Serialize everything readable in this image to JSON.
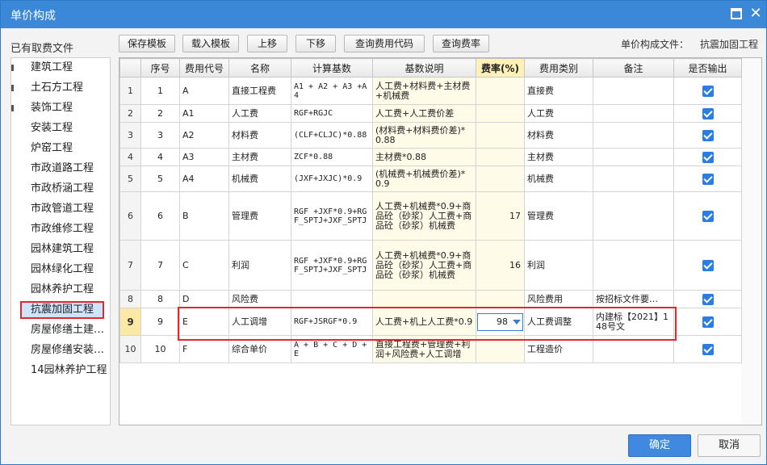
{
  "window": {
    "title": "单价构成"
  },
  "left_panel": {
    "label": "已有取费文件",
    "items": [
      "建筑工程",
      "土石方工程",
      "装饰工程",
      "安装工程",
      "炉窑工程",
      "市政道路工程",
      "市政桥涵工程",
      "市政管道工程",
      "市政维修工程",
      "园林建筑工程",
      "园林绿化工程",
      "园林养护工程",
      "抗震加固工程",
      "房屋修缮土建…",
      "房屋修缮安装…",
      "14园林养护工程"
    ],
    "selected": "抗震加固工程"
  },
  "toolbar": {
    "buttons": [
      "保存模板",
      "载入模板",
      "上移",
      "下移",
      "查询费用代码",
      "查询费率"
    ],
    "file_label": "单价构成文件：",
    "file_value": "抗震加固工程"
  },
  "table": {
    "headers": [
      "序号",
      "费用代号",
      "名称",
      "计算基数",
      "基数说明",
      "费率(%)",
      "费用类别",
      "备注",
      "是否输出"
    ],
    "rows": [
      {
        "idx": "1",
        "seq": "1",
        "code": "A",
        "name": "直接工程费",
        "base": "A1 + A2 + A3 +A4",
        "desc": "人工费+材料费+主材费+机械费",
        "rate": "",
        "category": "直接费",
        "note": "",
        "output": true
      },
      {
        "idx": "2",
        "seq": "2",
        "code": "A1",
        "name": "人工费",
        "base": "RGF+RGJC",
        "desc": "人工费+人工费价差",
        "rate": "",
        "category": "人工费",
        "note": "",
        "output": true
      },
      {
        "idx": "3",
        "seq": "3",
        "code": "A2",
        "name": "材料费",
        "base": "(CLF+CLJC)*0.88",
        "desc": "(材料费+材料费价差)*0.88",
        "rate": "",
        "category": "材料费",
        "note": "",
        "output": true
      },
      {
        "idx": "4",
        "seq": "4",
        "code": "A3",
        "name": "主材费",
        "base": "ZCF*0.88",
        "desc": "主材费*0.88",
        "rate": "",
        "category": "主材费",
        "note": "",
        "output": true
      },
      {
        "idx": "5",
        "seq": "5",
        "code": "A4",
        "name": "机械费",
        "base": "(JXF+JXJC)*0.9",
        "desc": "(机械费+机械费价差)*0.9",
        "rate": "",
        "category": "机械费",
        "note": "",
        "output": true
      },
      {
        "idx": "6",
        "seq": "6",
        "code": "B",
        "name": "管理费",
        "base": "RGF +JXF*0.9+RGF_SPTJ+JXF_SPTJ",
        "desc": "人工费+机械费*0.9+商品砼（砂浆）人工费+商品砼（砂浆）机械费",
        "rate": "17",
        "category": "管理费",
        "note": "",
        "output": true
      },
      {
        "idx": "7",
        "seq": "7",
        "code": "C",
        "name": "利润",
        "base": "RGF +JXF*0.9+RGF_SPTJ+JXF_SPTJ",
        "desc": "人工费+机械费*0.9+商品砼（砂浆）人工费+商品砼（砂浆）机械费",
        "rate": "16",
        "category": "利润",
        "note": "",
        "output": true
      },
      {
        "idx": "8",
        "seq": "8",
        "code": "D",
        "name": "风险费",
        "base": "",
        "desc": "",
        "rate": "",
        "category": "风险费用",
        "note": "按招标文件要…",
        "output": true
      },
      {
        "idx": "9",
        "seq": "9",
        "code": "E",
        "name": "人工调增",
        "base": "RGF+JSRGF*0.9",
        "desc": "人工费+机上人工费*0.9",
        "rate": "98",
        "category": "人工费调整",
        "note": "内建标【2021】148号文",
        "output": true
      },
      {
        "idx": "10",
        "seq": "10",
        "code": "F",
        "name": "综合单价",
        "base": "A + B + C + D + E",
        "desc": "直接工程费+管理费+利润+风险费+人工调增",
        "rate": "",
        "category": "工程造价",
        "note": "",
        "output": true
      }
    ],
    "active_row": "9"
  },
  "footer": {
    "ok": "确定",
    "cancel": "取消"
  },
  "colors": {
    "titlebar": "#3b87d8",
    "highlight_border": "#e0282e",
    "accent": "#3f8ae0"
  }
}
